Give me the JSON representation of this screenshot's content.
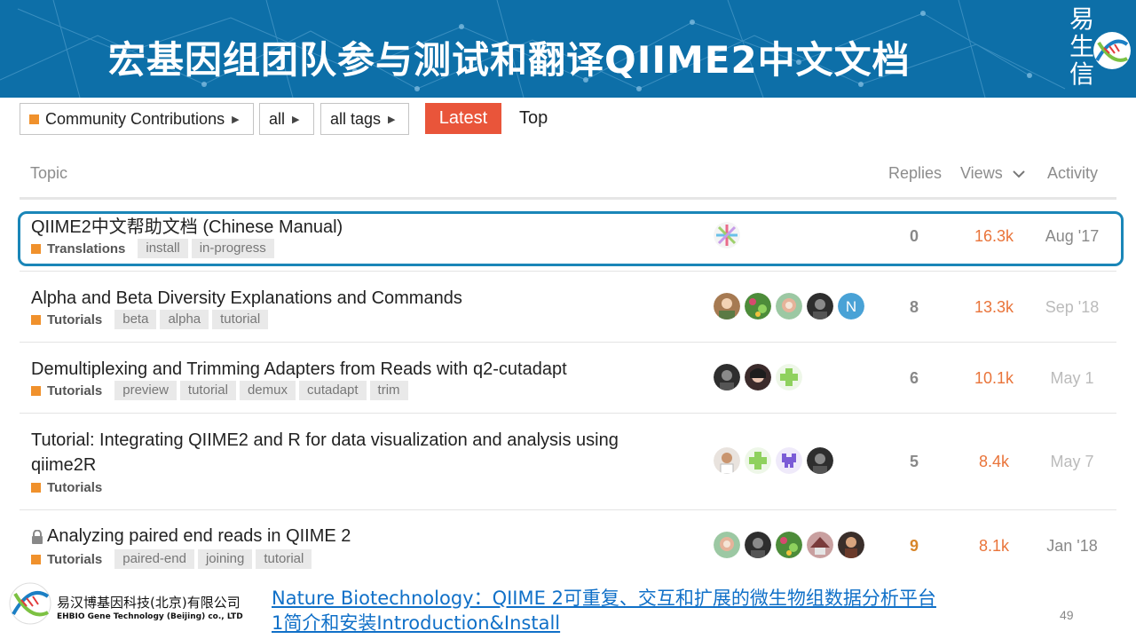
{
  "banner": {
    "title": "宏基因组团队参与测试和翻译QIIME2中文文档",
    "brand": [
      "易",
      "生",
      "信"
    ]
  },
  "filters": {
    "category": "Community Contributions",
    "scope": "all",
    "tags": "all tags",
    "tab_latest": "Latest",
    "tab_top": "Top"
  },
  "table": {
    "headers": {
      "topic": "Topic",
      "replies": "Replies",
      "views": "Views",
      "activity": "Activity"
    },
    "rows": [
      {
        "title": "QIIME2中文帮助文档 (Chinese Manual)",
        "category": "Translations",
        "tags": [
          "install",
          "in-progress"
        ],
        "replies": "0",
        "views": "16.3k",
        "activity": "Aug '17"
      },
      {
        "title": "Alpha and Beta Diversity Explanations and Commands",
        "category": "Tutorials",
        "tags": [
          "beta",
          "alpha",
          "tutorial"
        ],
        "replies": "8",
        "views": "13.3k",
        "activity": "Sep '18",
        "avatar_letter": "N"
      },
      {
        "title": "Demultiplexing and Trimming Adapters from Reads with q2-cutadapt",
        "category": "Tutorials",
        "tags": [
          "preview",
          "tutorial",
          "demux",
          "cutadapt",
          "trim"
        ],
        "replies": "6",
        "views": "10.1k",
        "activity": "May 1"
      },
      {
        "title": "Tutorial: Integrating QIIME2 and R for data visualization and analysis using qiime2R",
        "category": "Tutorials",
        "tags": [],
        "replies": "5",
        "views": "8.4k",
        "activity": "May 7"
      },
      {
        "title": "Analyzing paired end reads in QIIME 2",
        "category": "Tutorials",
        "tags": [
          "paired-end",
          "joining",
          "tutorial"
        ],
        "replies": "9",
        "views": "8.1k",
        "activity": "Jan '18"
      }
    ]
  },
  "footer": {
    "company_cn": "易汉博基因科技(北京)有限公司",
    "company_en": "EHBIO Gene Technology (Beijing) co., LTD",
    "link_line1": "Nature Biotechnology：QIIME 2可重复、交互和扩展的微生物组数据分析平台",
    "link_line2": "1简介和安装Introduction&Install",
    "page_number": "49"
  },
  "colors": {
    "banner": "#0d6fa8",
    "accent_orange": "#f0912c",
    "latest_tab": "#e9553a",
    "highlight_border": "#1a86b8",
    "views": "#e9743a",
    "link": "#1070c8"
  }
}
